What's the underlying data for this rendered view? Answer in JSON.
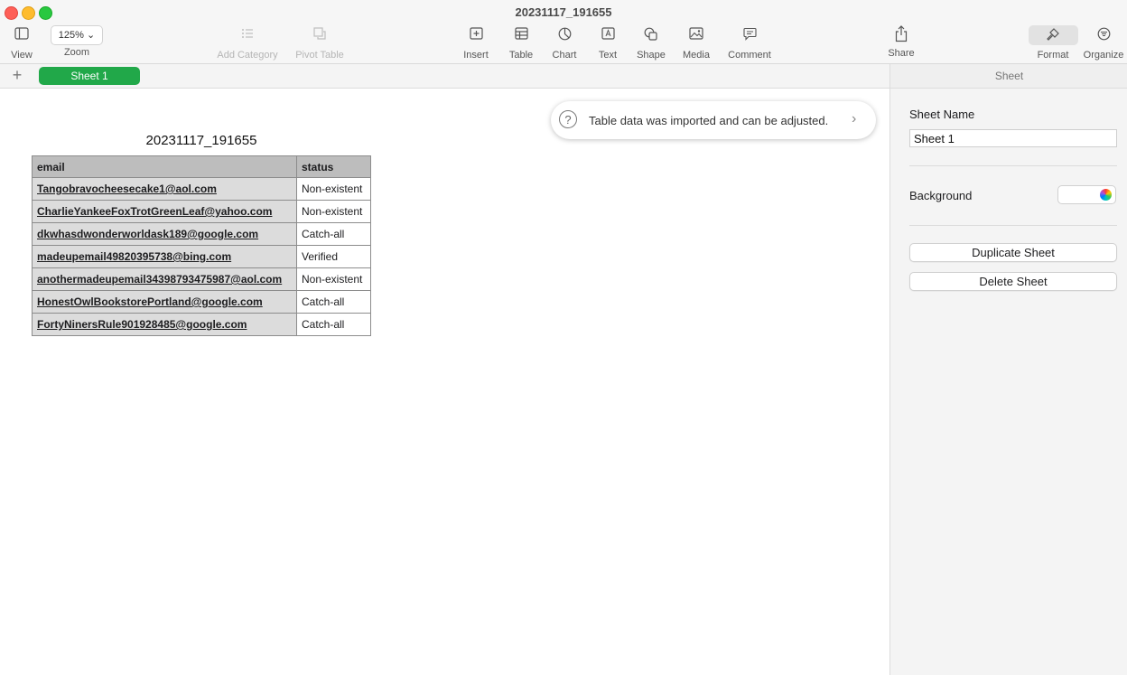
{
  "window": {
    "title": "20231117_191655"
  },
  "toolbar": {
    "view": "View",
    "zoom_value": "125%",
    "zoom": "Zoom",
    "add_category": "Add Category",
    "pivot_table": "Pivot Table",
    "insert": "Insert",
    "table": "Table",
    "chart": "Chart",
    "text": "Text",
    "shape": "Shape",
    "media": "Media",
    "comment": "Comment",
    "share": "Share",
    "format": "Format",
    "organize": "Organize"
  },
  "tabs": {
    "add": "+",
    "active": "Sheet 1"
  },
  "notification": {
    "message": "Table data was imported and can be adjusted."
  },
  "table": {
    "title": "20231117_191655",
    "headers": [
      "email",
      "status"
    ],
    "rows": [
      [
        "Tangobravocheesecake1@aol.com",
        "Non-existent"
      ],
      [
        "CharlieYankeeFoxTrotGreenLeaf@yahoo.com",
        "Non-existent"
      ],
      [
        "dkwhasdwonderworldask189@google.com",
        "Catch-all"
      ],
      [
        "madeupemail49820395738@bing.com",
        "Verified"
      ],
      [
        "anothermadeupemail34398793475987@aol.com",
        "Non-existent"
      ],
      [
        "HonestOwlBookstorePortland@google.com",
        "Catch-all"
      ],
      [
        "FortyNinersRule901928485@google.com",
        "Catch-all"
      ]
    ]
  },
  "sidebar": {
    "header": "Sheet",
    "sheet_name_label": "Sheet Name",
    "sheet_name_value": "Sheet 1",
    "background_label": "Background",
    "duplicate": "Duplicate Sheet",
    "delete": "Delete Sheet"
  }
}
